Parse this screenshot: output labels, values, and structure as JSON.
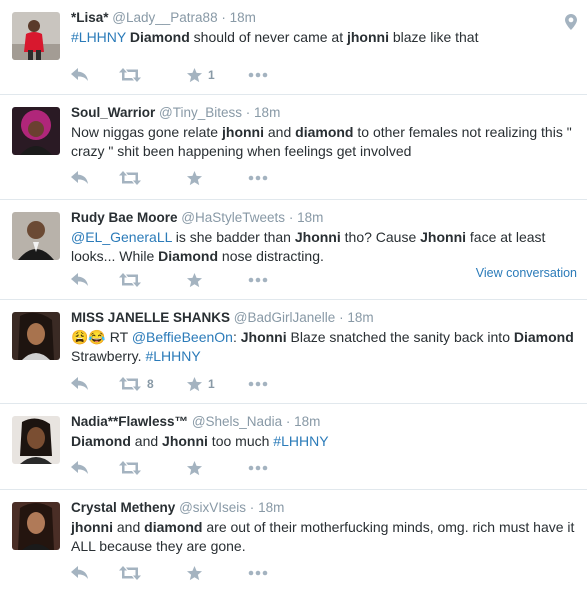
{
  "tweets": [
    {
      "fullname": "*Lisa*",
      "username": "@Lady__Patra88",
      "time": "18m",
      "text": [
        {
          "t": "#LHHNY",
          "s": "hashtag"
        },
        {
          "t": " "
        },
        {
          "t": "Diamond",
          "s": "bold"
        },
        {
          "t": " should of never came at "
        },
        {
          "t": "jhonni",
          "s": "bold"
        },
        {
          "t": " blaze like that"
        }
      ],
      "retweets": "",
      "favorites": "1",
      "has_geo": true,
      "view_conversation": ""
    },
    {
      "fullname": "Soul_Warrior",
      "username": "@Tiny_Bitess",
      "time": "18m",
      "text": [
        {
          "t": "Now niggas gone relate "
        },
        {
          "t": "jhonni",
          "s": "bold"
        },
        {
          "t": " and "
        },
        {
          "t": "diamond",
          "s": "bold"
        },
        {
          "t": " to other females not realizing this \" crazy \" shit been happening when feelings get involved"
        }
      ],
      "retweets": "",
      "favorites": "",
      "has_geo": false,
      "view_conversation": ""
    },
    {
      "fullname": "Rudy Bae Moore",
      "username": "@HaStyleTweets",
      "time": "18m",
      "text": [
        {
          "t": "@EL_GeneraLL",
          "s": "mention"
        },
        {
          "t": " is she badder than "
        },
        {
          "t": "Jhonni",
          "s": "bold"
        },
        {
          "t": " tho? Cause "
        },
        {
          "t": "Jhonni",
          "s": "bold"
        },
        {
          "t": " face at least looks... While "
        },
        {
          "t": "Diamond",
          "s": "bold"
        },
        {
          "t": " nose distracting."
        }
      ],
      "retweets": "",
      "favorites": "",
      "has_geo": false,
      "view_conversation": "View conversation"
    },
    {
      "fullname": "MISS JANELLE SHANKS",
      "username": "@BadGirlJanelle",
      "time": "18m",
      "text": [
        {
          "t": "😩😂",
          "s": "emoji"
        },
        {
          "t": " RT "
        },
        {
          "t": "@BeffieBeenOn",
          "s": "mention"
        },
        {
          "t": ": "
        },
        {
          "t": "Jhonni",
          "s": "bold"
        },
        {
          "t": " Blaze snatched the sanity back into "
        },
        {
          "t": "Diamond",
          "s": "bold"
        },
        {
          "t": " Strawberry. "
        },
        {
          "t": "#LHHNY",
          "s": "hashtag"
        }
      ],
      "retweets": "8",
      "favorites": "1",
      "has_geo": false,
      "view_conversation": ""
    },
    {
      "fullname": "Nadia**Flawless™",
      "username": "@Shels_Nadia",
      "time": "18m",
      "text": [
        {
          "t": "Diamond",
          "s": "bold"
        },
        {
          "t": " and "
        },
        {
          "t": "Jhonni",
          "s": "bold"
        },
        {
          "t": " too much  "
        },
        {
          "t": "#LHHNY",
          "s": "hashtag"
        }
      ],
      "retweets": "",
      "favorites": "",
      "has_geo": false,
      "view_conversation": ""
    },
    {
      "fullname": "Crystal Metheny",
      "username": "@sixVIseis",
      "time": "18m",
      "text": [
        {
          "t": "jhonni",
          "s": "bold"
        },
        {
          "t": " and "
        },
        {
          "t": "diamond",
          "s": "bold"
        },
        {
          "t": " are out of their motherfucking minds, omg. rich must have it ALL because they are gone."
        }
      ],
      "retweets": "",
      "favorites": "",
      "has_geo": false,
      "view_conversation": ""
    }
  ],
  "separator": "·",
  "colors": {
    "link": "#2b7bb9",
    "secondary": "#8899a6",
    "action_icon": "#a4b3c0",
    "text": "#292f33",
    "divider": "#e1e8ed"
  },
  "icons": [
    "reply-icon",
    "retweet-icon",
    "favorite-icon",
    "more-icon",
    "geo-location-icon"
  ]
}
